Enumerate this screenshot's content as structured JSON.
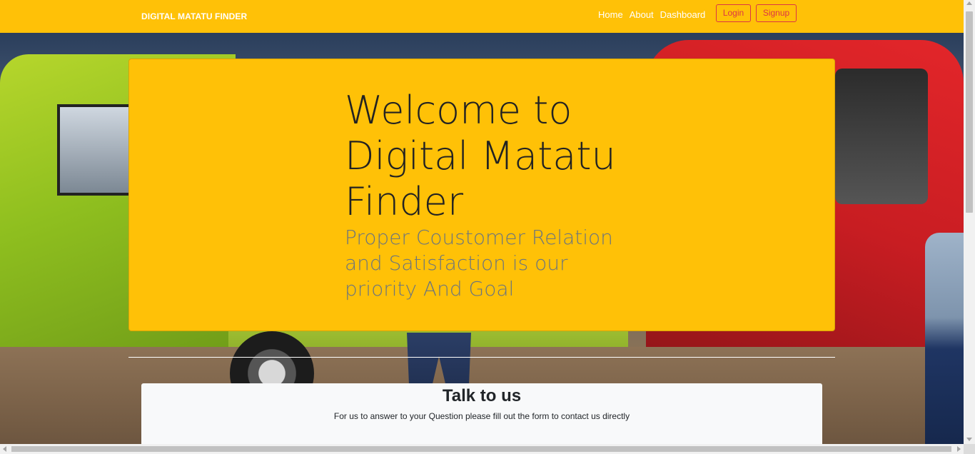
{
  "navbar": {
    "brand": "DIGITAL MATATU FINDER",
    "links": [
      "Home",
      "About",
      "Dashboard"
    ],
    "login_label": "Login",
    "signup_label": "Signup",
    "background_color": "#ffc107",
    "button_color": "#dc3545"
  },
  "hero": {
    "title": "Welcome to Digital Matatu Finder",
    "subtitle": "Proper Coustomer Relation and Satisfaction is our priority And Goal",
    "background_color": "#ffc107"
  },
  "contact": {
    "title": "Talk to us",
    "description": "For us to answer to your Question please fill out the form to contact us directly"
  }
}
